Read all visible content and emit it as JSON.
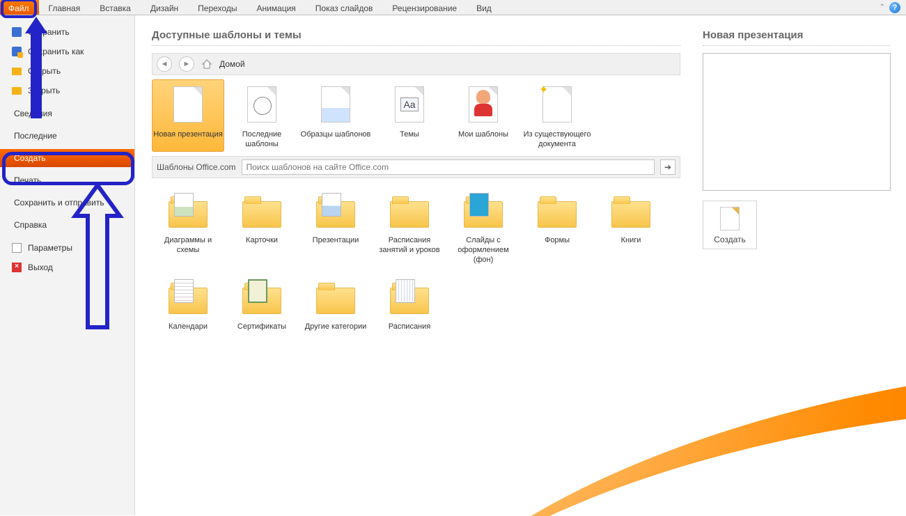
{
  "ribbon": {
    "file": "Файл",
    "tabs": [
      "Главная",
      "Вставка",
      "Дизайн",
      "Переходы",
      "Анимация",
      "Показ слайдов",
      "Рецензирование",
      "Вид"
    ]
  },
  "sidebar": {
    "save": "Сохранить",
    "save_as": "Сохранить как",
    "open": "Открыть",
    "close": "Закрыть",
    "info": "Сведения",
    "recent": "Последние",
    "new": "Создать",
    "print": "Печать",
    "share": "Сохранить и отправить",
    "help": "Справка",
    "options": "Параметры",
    "exit": "Выход"
  },
  "main": {
    "section_title": "Доступные шаблоны и темы",
    "breadcrumb_home": "Домой",
    "templates_row1": [
      {
        "label": "Новая презентация"
      },
      {
        "label": "Последние шаблоны"
      },
      {
        "label": "Образцы шаблонов"
      },
      {
        "label": "Темы"
      },
      {
        "label": "Мои шаблоны"
      },
      {
        "label": "Из существую­щего документа"
      }
    ],
    "office_section_label": "Шаблоны Office.com",
    "search_placeholder": "Поиск шаблонов на сайте Office.com",
    "templates_row2": [
      {
        "label": "Диаграммы и схемы"
      },
      {
        "label": "Карточки"
      },
      {
        "label": "Презентации"
      },
      {
        "label": "Расписания занятий и уроков"
      },
      {
        "label": "Слайды с оформлением (фон)"
      },
      {
        "label": "Формы"
      },
      {
        "label": "Книги"
      }
    ],
    "templates_row3": [
      {
        "label": "Календари"
      },
      {
        "label": "Сертификаты"
      },
      {
        "label": "Другие категории"
      },
      {
        "label": "Расписания"
      }
    ]
  },
  "preview": {
    "title": "Новая презентация",
    "create_button": "Создать"
  }
}
